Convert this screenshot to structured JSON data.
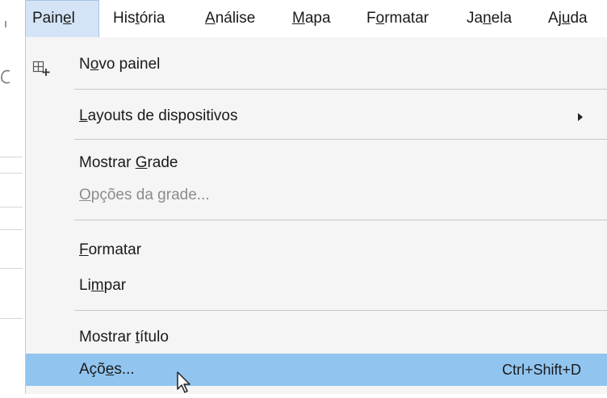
{
  "menubar": {
    "items": [
      {
        "label": "Painel",
        "prefix": "Pain",
        "mnemonic": "e",
        "suffix": "l"
      },
      {
        "label": "História",
        "prefix": "His",
        "mnemonic": "t",
        "suffix": "ória"
      },
      {
        "label": "Análise",
        "prefix": "",
        "mnemonic": "A",
        "suffix": "nálise"
      },
      {
        "label": "Mapa",
        "prefix": "",
        "mnemonic": "M",
        "suffix": "apa"
      },
      {
        "label": "Formatar",
        "prefix": "F",
        "mnemonic": "o",
        "suffix": "rmatar"
      },
      {
        "label": "Janela",
        "prefix": "Ja",
        "mnemonic": "n",
        "suffix": "ela"
      },
      {
        "label": "Ajuda",
        "prefix": "Aj",
        "mnemonic": "u",
        "suffix": "da"
      }
    ]
  },
  "dropdown": {
    "items": [
      {
        "prefix": "N",
        "mnemonic": "o",
        "suffix": "vo painel",
        "icon": "new-panel-icon"
      },
      {
        "prefix": "",
        "mnemonic": "L",
        "suffix": "ayouts de dispositivos",
        "submenu": true
      },
      {
        "prefix": "Mostrar ",
        "mnemonic": "G",
        "suffix": "rade"
      },
      {
        "prefix": "",
        "mnemonic": "O",
        "suffix": "pções da grade...",
        "disabled": true
      },
      {
        "prefix": "",
        "mnemonic": "F",
        "suffix": "ormatar"
      },
      {
        "prefix": "Li",
        "mnemonic": "m",
        "suffix": "par"
      },
      {
        "prefix": "Mostrar ",
        "mnemonic": "t",
        "suffix": "ítulo"
      },
      {
        "prefix": "Açõ",
        "mnemonic": "e",
        "suffix": "s...",
        "shortcut": "Ctrl+Shift+D",
        "highlighted": true
      }
    ]
  },
  "colors": {
    "highlight": "#91c5f0",
    "menu_bg": "#f5f5f5",
    "open_menu_bg": "#d4e4f6",
    "disabled_text": "#8c8c8c"
  }
}
